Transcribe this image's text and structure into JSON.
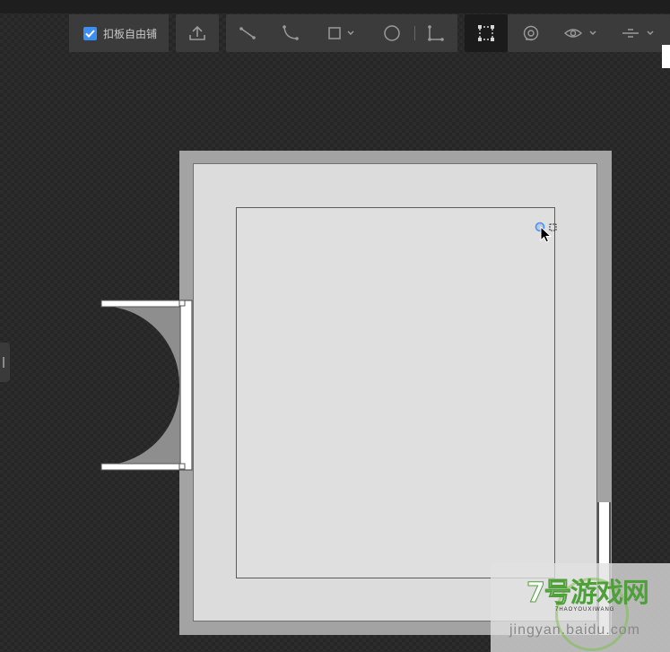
{
  "toolbar": {
    "free_tile_checkbox": {
      "label": "扣板自由铺",
      "checked": true
    },
    "buttons": [
      {
        "name": "upload-icon"
      },
      {
        "name": "straight-line-icon"
      },
      {
        "name": "curve-line-icon"
      },
      {
        "name": "rectangle-icon",
        "has_dropdown": true
      },
      {
        "name": "circle-icon"
      },
      {
        "name": "corner-icon"
      },
      {
        "name": "selection-frame-icon",
        "active": true
      },
      {
        "name": "rotate-icon"
      },
      {
        "name": "eye-icon",
        "has_dropdown": true
      },
      {
        "name": "align-icon",
        "has_dropdown": true
      }
    ]
  },
  "colors": {
    "accent": "#3d8ef2",
    "canvas_bg": "#262626",
    "wall": "#a3a3a3",
    "floor": "#dcdcdc"
  },
  "watermark": {
    "logo_prefix": "7号",
    "logo_main": "游戏网",
    "sub": "7HAOYOUXIWANG",
    "url": "jingyan.baidu.com"
  }
}
